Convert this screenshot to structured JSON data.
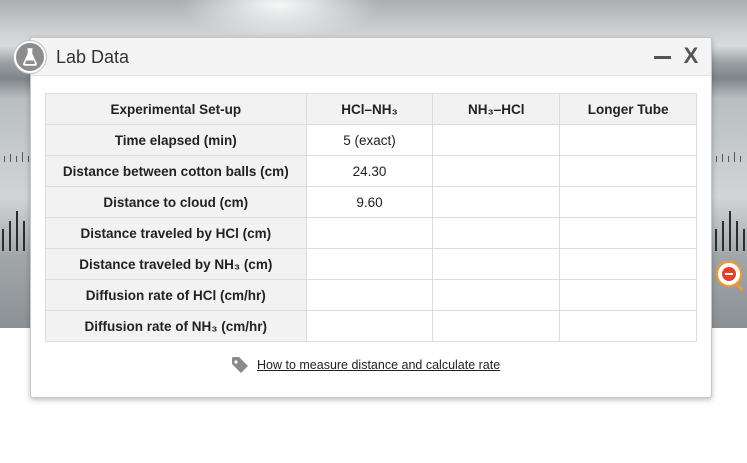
{
  "dialog": {
    "title": "Lab Data",
    "minimize_label": "—",
    "close_label": "X",
    "icon": "flask-icon"
  },
  "table": {
    "headers": [
      "Experimental Set-up",
      "HCl–NH₃",
      "NH₃–HCl",
      "Longer Tube"
    ],
    "rows": [
      {
        "label": "Time elapsed (min)",
        "cells": [
          "5 (exact)",
          "",
          ""
        ]
      },
      {
        "label": "Distance between cotton balls (cm)",
        "cells": [
          "24.30",
          "",
          ""
        ]
      },
      {
        "label": "Distance to cloud (cm)",
        "cells": [
          "9.60",
          "",
          ""
        ]
      },
      {
        "label": "Distance traveled by HCl (cm)",
        "cells": [
          "",
          "",
          ""
        ]
      },
      {
        "label": "Distance traveled by NH₃ (cm)",
        "cells": [
          "",
          "",
          ""
        ]
      },
      {
        "label": "Diffusion rate of HCl (cm/hr)",
        "cells": [
          "",
          "",
          ""
        ]
      },
      {
        "label": "Diffusion rate of NH₃ (cm/hr)",
        "cells": [
          "",
          "",
          ""
        ]
      }
    ]
  },
  "help": {
    "icon": "tag-icon",
    "link_text": "How to measure distance and calculate rate"
  },
  "background": {
    "zoom_button_icon": "zoom-out-icon"
  },
  "colors": {
    "header_bg": "#f4f4f4",
    "table_header_bg": "#f2f2f2",
    "badge_bg": "#8d8d8d",
    "zoom_ring": "#f39a2c",
    "zoom_fill": "#e2402b"
  }
}
